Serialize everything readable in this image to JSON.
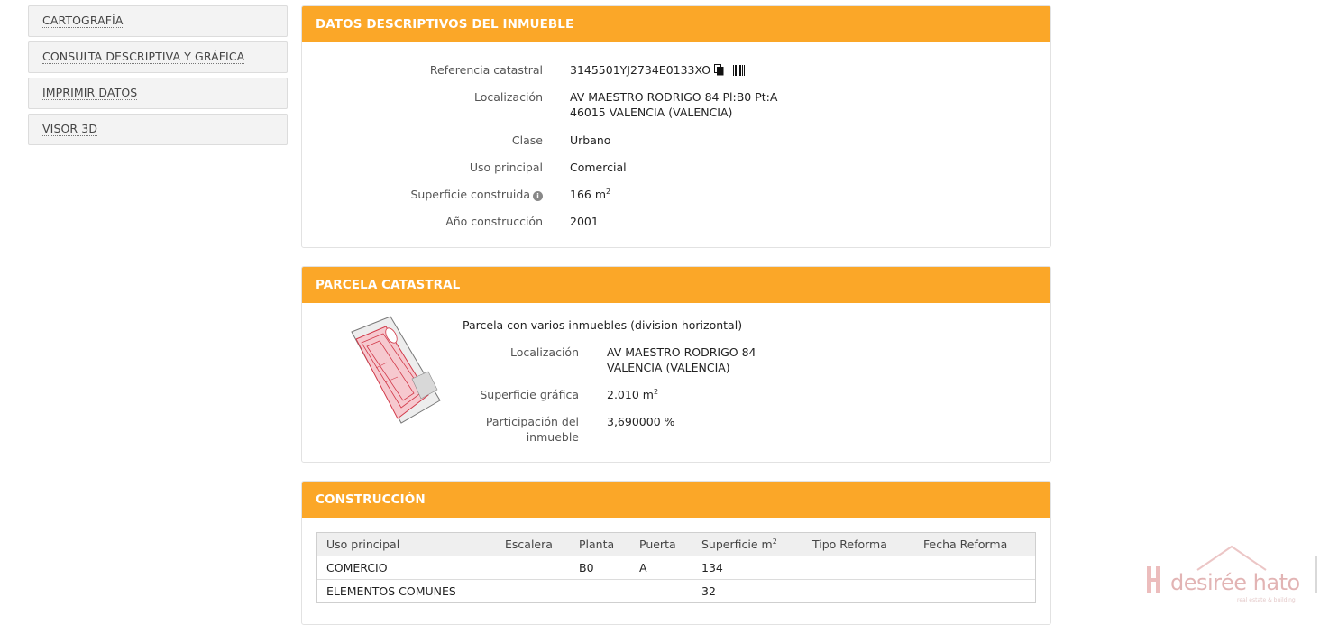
{
  "sidebar": {
    "items": [
      {
        "label": "CARTOGRAFÍA"
      },
      {
        "label": "CONSULTA DESCRIPTIVA Y GRÁFICA"
      },
      {
        "label": "IMPRIMIR DATOS"
      },
      {
        "label": "VISOR 3D"
      }
    ]
  },
  "descriptivos": {
    "title": "DATOS DESCRIPTIVOS DEL INMUEBLE",
    "ref_label": "Referencia catastral",
    "ref_value": "3145501YJ2734E0133XO",
    "loc_label": "Localización",
    "loc_line1": "AV MAESTRO RODRIGO 84 Pl:B0 Pt:A",
    "loc_line2": "46015 VALENCIA (VALENCIA)",
    "clase_label": "Clase",
    "clase_value": "Urbano",
    "uso_label": "Uso principal",
    "uso_value": "Comercial",
    "sup_label": "Superficie construida",
    "sup_value": "166 m",
    "sup_unit_exp": "2",
    "anio_label": "Año construcción",
    "anio_value": "2001"
  },
  "parcela": {
    "title": "PARCELA CATASTRAL",
    "subtitle": "Parcela con varios inmuebles (division horizontal)",
    "loc_label": "Localización",
    "loc_line1": "AV MAESTRO RODRIGO 84",
    "loc_line2": "VALENCIA (VALENCIA)",
    "sup_label": "Superficie gráfica",
    "sup_value": "2.010 m",
    "sup_unit_exp": "2",
    "part_label_1": "Participación del",
    "part_label_2": "inmueble",
    "part_value": "3,690000 %"
  },
  "construccion": {
    "title": "CONSTRUCCIÓN",
    "headers": [
      "Uso principal",
      "Escalera",
      "Planta",
      "Puerta",
      "Superficie m",
      "Tipo Reforma",
      "Fecha Reforma"
    ],
    "sup_header_exp": "2",
    "rows": [
      [
        "COMERCIO",
        "",
        "B0",
        "A",
        "134",
        "",
        ""
      ],
      [
        "ELEMENTOS COMUNES",
        "",
        "",
        "",
        "32",
        "",
        ""
      ]
    ]
  },
  "watermark": {
    "brand": "desirée hato",
    "tagline": "real estate & building"
  },
  "colors": {
    "header_orange": "#fba728",
    "parcel_fill": "#f6c9cf",
    "parcel_stroke": "#d23a4a"
  }
}
